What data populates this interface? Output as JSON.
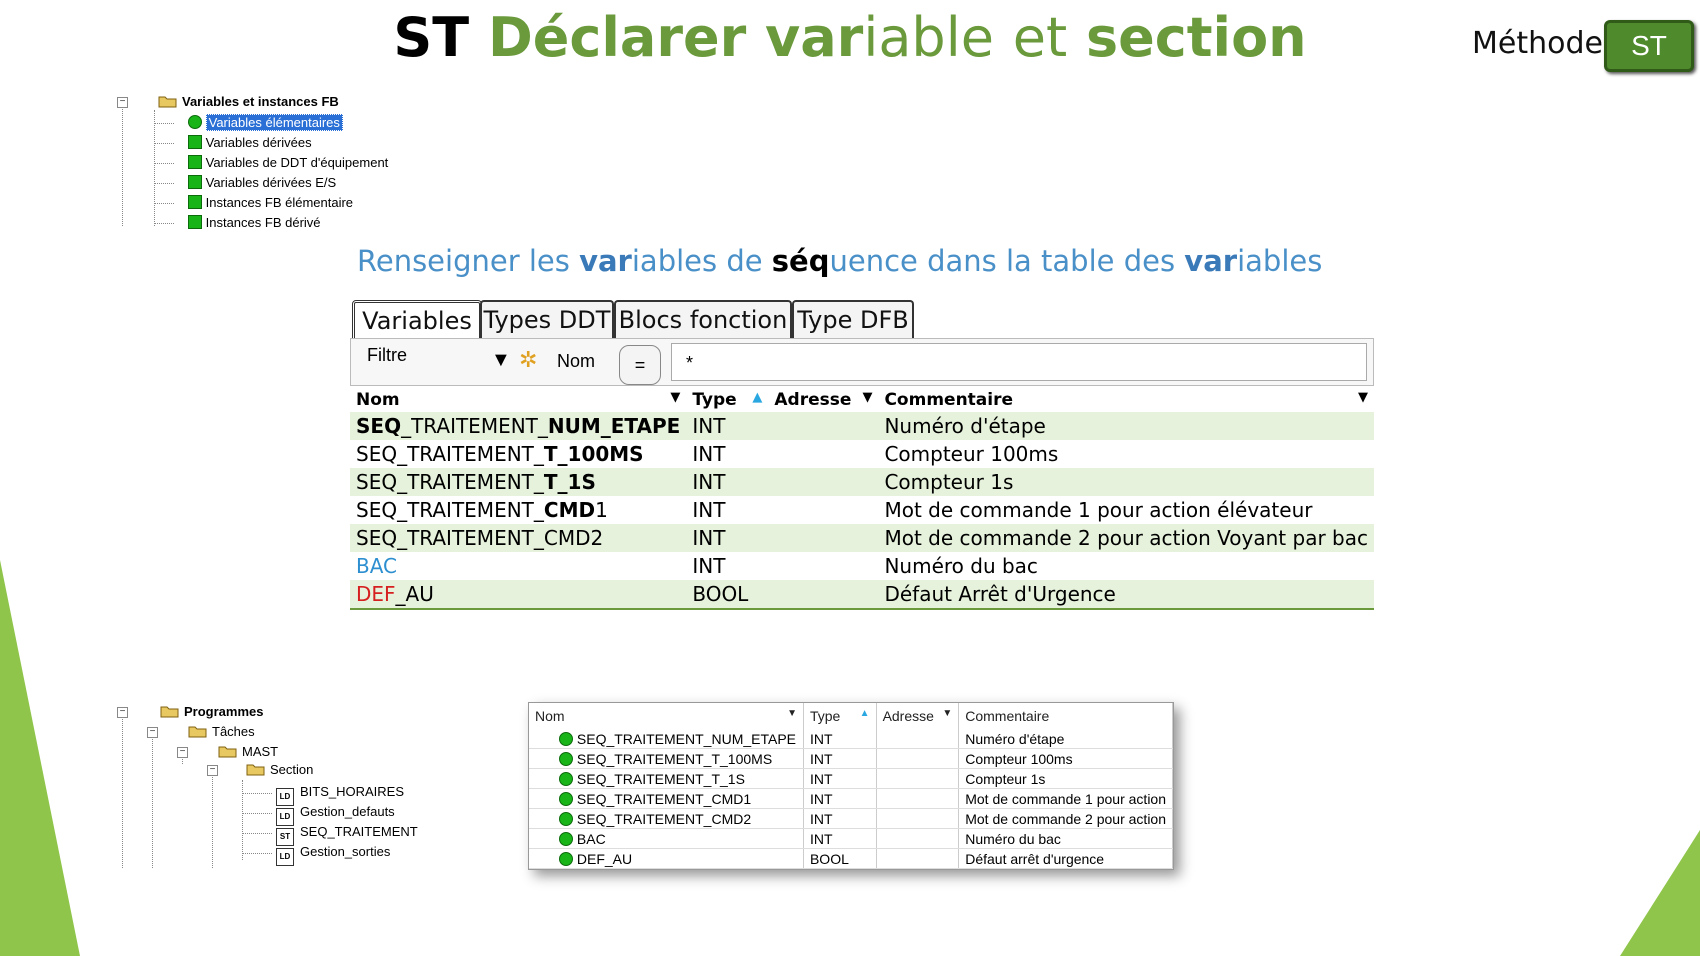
{
  "title": {
    "part1": "ST",
    "part2": "Déclarer",
    "part3": "var",
    "part4": "iable",
    "part5": "et",
    "part6": "section"
  },
  "method": {
    "label": "Méthode",
    "badge": "ST"
  },
  "tree_vars": {
    "root": "Variables et instances FB",
    "items": [
      "Variables élémentaires",
      "Variables dérivées",
      "Variables de DDT d'équipement",
      "Variables dérivées E/S",
      "Instances FB élémentaire",
      "Instances FB dérivé"
    ]
  },
  "subtitle": {
    "a": "Renseigner les ",
    "b": "var",
    "c": "iables de ",
    "d": "séq",
    "e": "uence dans la table des ",
    "f": "var",
    "g": "iables"
  },
  "tabs": [
    "Variables",
    "Types DDT",
    "Blocs fonction",
    "Type DFB"
  ],
  "filter": {
    "label": "Filtre",
    "name_label": "Nom",
    "equals": "=",
    "value": "*"
  },
  "columns": [
    "Nom",
    "Type",
    "Adresse",
    "Commentaire"
  ],
  "rows": [
    {
      "name_pre": "SEQ",
      "name_mid": "_TRAITEMENT_",
      "name_bold": "NUM_ETAPE",
      "name_post": "",
      "type": "INT",
      "address": "",
      "comment": "Numéro d'étape"
    },
    {
      "name_pre": "",
      "name_mid": "SEQ_TRAITEMENT_",
      "name_bold": "T_100MS",
      "name_post": "",
      "type": "INT",
      "address": "",
      "comment": "Compteur 100ms"
    },
    {
      "name_pre": "",
      "name_mid": "SEQ_TRAITEMENT_",
      "name_bold": "T_1S",
      "name_post": "",
      "type": "INT",
      "address": "",
      "comment": "Compteur 1s"
    },
    {
      "name_pre": "",
      "name_mid": "SEQ_TRAITEMENT_",
      "name_bold": "CMD",
      "name_post": "1",
      "type": "INT",
      "address": "",
      "comment": "Mot de commande 1 pour action élévateur"
    },
    {
      "name_pre": "",
      "name_mid": "SEQ_TRAITEMENT_CMD2",
      "name_bold": "",
      "name_post": "",
      "type": "INT",
      "address": "",
      "comment": "Mot de commande 2 pour action Voyant par bac"
    },
    {
      "name_pre": "",
      "name_mid": "BAC",
      "name_bold": "",
      "name_post": "",
      "type": "INT",
      "address": "",
      "comment": "Numéro du bac"
    },
    {
      "name_pre": "",
      "name_mid": "DEF",
      "name_bold": "",
      "name_post": "_AU",
      "type": "BOOL",
      "address": "",
      "comment": "Défaut Arrêt d'Urgence"
    }
  ],
  "tree_prog": {
    "root": "Programmes",
    "taches": "Tâches",
    "mast": "MAST",
    "section": "Section",
    "sections": [
      {
        "kind": "LD",
        "name": "BITS_HORAIRES"
      },
      {
        "kind": "LD",
        "name": "Gestion_defauts"
      },
      {
        "kind": "ST",
        "name": "SEQ_TRAITEMENT"
      },
      {
        "kind": "LD",
        "name": "Gestion_sorties"
      }
    ]
  },
  "mini": {
    "columns": [
      "Nom",
      "Type",
      "Adresse",
      "Commentaire"
    ],
    "rows": [
      [
        "SEQ_TRAITEMENT_NUM_ETAPE",
        "INT",
        "",
        "Numéro d'étape"
      ],
      [
        "SEQ_TRAITEMENT_T_100MS",
        "INT",
        "",
        "Compteur 100ms"
      ],
      [
        "SEQ_TRAITEMENT_T_1S",
        "INT",
        "",
        "Compteur 1s"
      ],
      [
        "SEQ_TRAITEMENT_CMD1",
        "INT",
        "",
        "Mot de commande 1 pour action"
      ],
      [
        "SEQ_TRAITEMENT_CMD2",
        "INT",
        "",
        "Mot de commande 2 pour action"
      ],
      [
        "BAC",
        "INT",
        "",
        "Numéro du bac"
      ],
      [
        "DEF_AU",
        "BOOL",
        "",
        "Défaut arrêt d'urgence"
      ]
    ]
  },
  "colors": {
    "green_title": "#6a9a3b",
    "badge": "#4f8a2c",
    "row_alt": "#e6f2dc",
    "subtitle": "#4a90c8"
  }
}
